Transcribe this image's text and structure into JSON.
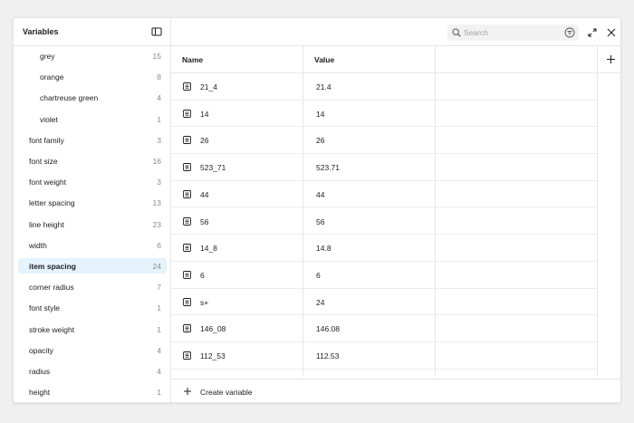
{
  "sidebar": {
    "title": "Variables",
    "items": [
      {
        "label": "grey",
        "count": "15",
        "level": "sub"
      },
      {
        "label": "orange",
        "count": "8",
        "level": "sub"
      },
      {
        "label": "chartreuse green",
        "count": "4",
        "level": "sub"
      },
      {
        "label": "violet",
        "count": "1",
        "level": "sub"
      },
      {
        "label": "font family",
        "count": "3",
        "level": "top"
      },
      {
        "label": "font size",
        "count": "16",
        "level": "top"
      },
      {
        "label": "font weight",
        "count": "3",
        "level": "top"
      },
      {
        "label": "letter spacing",
        "count": "13",
        "level": "top"
      },
      {
        "label": "line height",
        "count": "23",
        "level": "top"
      },
      {
        "label": "width",
        "count": "6",
        "level": "top"
      },
      {
        "label": "item spacing",
        "count": "24",
        "level": "top",
        "selected": true
      },
      {
        "label": "corner radius",
        "count": "7",
        "level": "top"
      },
      {
        "label": "font style",
        "count": "1",
        "level": "top"
      },
      {
        "label": "stroke weight",
        "count": "1",
        "level": "top"
      },
      {
        "label": "opacity",
        "count": "4",
        "level": "top"
      },
      {
        "label": "radius",
        "count": "4",
        "level": "top"
      },
      {
        "label": "height",
        "count": "1",
        "level": "top"
      }
    ]
  },
  "search": {
    "placeholder": "Search"
  },
  "table": {
    "columns": [
      "Name",
      "Value"
    ],
    "rows": [
      {
        "name": "21_4",
        "value": "21.4"
      },
      {
        "name": "14",
        "value": "14"
      },
      {
        "name": "26",
        "value": "26"
      },
      {
        "name": "523_71",
        "value": "523.71"
      },
      {
        "name": "44",
        "value": "44"
      },
      {
        "name": "56",
        "value": "56"
      },
      {
        "name": "14_8",
        "value": "14.8"
      },
      {
        "name": "6",
        "value": "6"
      },
      {
        "name": "s+",
        "value": "24"
      },
      {
        "name": "146_08",
        "value": "146.08"
      },
      {
        "name": "112_53",
        "value": "112.53"
      }
    ]
  },
  "footer": {
    "create_label": "Create variable"
  },
  "colors": {
    "selected_bg": "#e5f3fd",
    "border": "#e6e6e6",
    "muted": "#8a8a8a"
  }
}
